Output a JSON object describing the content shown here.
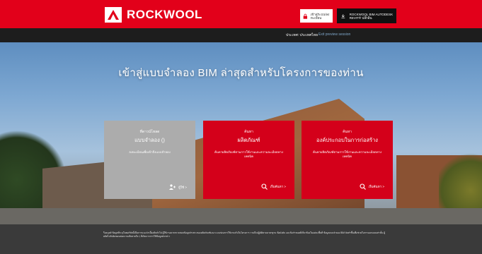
{
  "header": {
    "brand": "ROCKWOOL",
    "login_label": "เข้าสู่ระบบ/ลงทะเบียน",
    "bim_label": "ROCKWOOL BIM AUTODESK REVIT® ปลั๊กอิน"
  },
  "subbar": {
    "country": "ประเทศ: ประเทศไทย",
    "preview_link": "Exit preview session"
  },
  "hero": {
    "title": "เข้าสู่แบบจำลอง BIM ล่าสุดสำหรับโครงการของท่าน"
  },
  "cards": [
    {
      "small": "ที่ดาวน์โหลด",
      "big": "แบบจำลอง ()",
      "desc": "ลงทะเบียนเพื่อเข้าถึงแบบจำลอง",
      "action": "ผู้ใช้ >"
    },
    {
      "small": "ค้นหา",
      "big": "ผลิตภัณฑ์",
      "desc": "ค้นหาผลิตภัณฑ์ตามการใช้งานและความละเอียดทางเทคนิค",
      "action": "เริ่มค้นหา >"
    },
    {
      "small": "ค้นหา",
      "big": "องค์ประกอบในการก่อสร้าง",
      "desc": "ค้นหาผลิตภัณฑ์ตามการใช้งานและความละเอียดทางเทคนิค",
      "action": "เริ่มค้นหา >"
    }
  ],
  "footer": {
    "legal": "ร็อควูลส์ ข้อมูลที่ระบุในพอร์ทัลนี้เป็นการแนะนำเบื้องต้นทั่วไป ผู้ใช้งานควรตรวจสอบข้อมูลจำเพาะของผลิตภัณฑ์และระบบก่อนการใช้งานจริงในโครงการ รวมถึงปฏิบัติตามมาตรฐาน ข้อบังคับ และข้อกำหนดที่เกี่ยวข้องในแต่ละพื้นที่ ข้อมูลแบบจำลอง BIM จัดทำขึ้นเพื่อช่วยในการออกแบบเท่านั้น ผู้ผลิตไม่รับผิดชอบต่อความเสียหายใด ๆ ที่เกิดจากการใช้ข้อมูลดังกล่าว"
  },
  "colors": {
    "brand_red": "#e2001a",
    "card_red": "#d4001a",
    "card_grey": "#acacac",
    "subbar": "#1d1d1d",
    "footer": "#3a3a3a"
  }
}
